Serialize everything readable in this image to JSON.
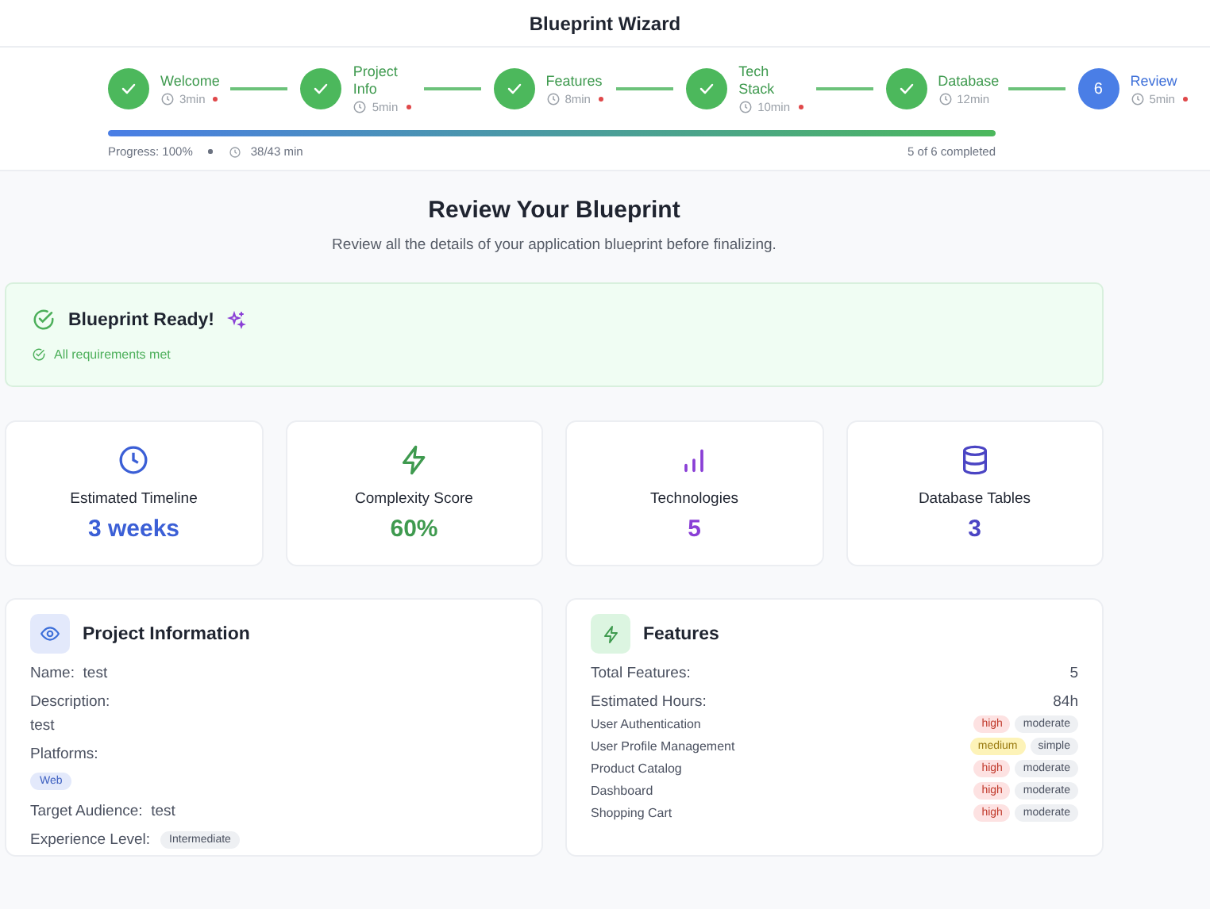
{
  "window": {
    "title": "Blueprint Wizard"
  },
  "steps": [
    {
      "label": "Welcome",
      "time": "3min",
      "completed": true,
      "current": false,
      "required": true
    },
    {
      "label": "Project Info",
      "time": "5min",
      "completed": true,
      "current": false,
      "required": true
    },
    {
      "label": "Features",
      "time": "8min",
      "completed": true,
      "current": false,
      "required": true
    },
    {
      "label": "Tech Stack",
      "time": "10min",
      "completed": true,
      "current": false,
      "required": true
    },
    {
      "label": "Database",
      "time": "12min",
      "completed": true,
      "current": false,
      "required": false
    },
    {
      "label": "Review",
      "number": "6",
      "time": "5min",
      "completed": false,
      "current": true,
      "required": true
    }
  ],
  "progress": {
    "level": 1,
    "label": "Progress: 100%",
    "time": "38/43 min",
    "completed": "5 of 6 completed"
  },
  "heading": "Review Your Blueprint",
  "subheading": "Review all the details of your application blueprint before finalizing.",
  "ready": {
    "title": "Blueprint Ready!",
    "note": "All requirements met"
  },
  "stats": [
    {
      "label": "Estimated Timeline",
      "value": "3 weeks",
      "color": "#3b5fd6"
    },
    {
      "label": "Complexity Score",
      "value": "60%",
      "color": "#3f9a4f"
    },
    {
      "label": "Technologies",
      "value": "5",
      "color": "#8a3fd6"
    },
    {
      "label": "Database Tables",
      "value": "3",
      "color": "#4b45c4"
    }
  ],
  "project": {
    "title": "Project Information",
    "name_label": "Name:",
    "name": "test",
    "description_label": "Description:",
    "description": "test",
    "platforms_label": "Platforms:",
    "platforms": [
      "Web"
    ],
    "audience_label": "Target Audience:",
    "audience": "test",
    "experience_label": "Experience Level:",
    "experience": "Intermediate"
  },
  "features": {
    "title": "Features",
    "total_label": "Total Features:",
    "total": "5",
    "hours_label": "Estimated Hours:",
    "hours": "84h",
    "items": [
      {
        "name": "User Authentication",
        "priority": "high",
        "complexity": "moderate"
      },
      {
        "name": "User Profile Management",
        "priority": "medium",
        "complexity": "simple"
      },
      {
        "name": "Product Catalog",
        "priority": "high",
        "complexity": "moderate"
      },
      {
        "name": "Dashboard",
        "priority": "high",
        "complexity": "moderate"
      },
      {
        "name": "Shopping Cart",
        "priority": "high",
        "complexity": "moderate"
      }
    ]
  }
}
